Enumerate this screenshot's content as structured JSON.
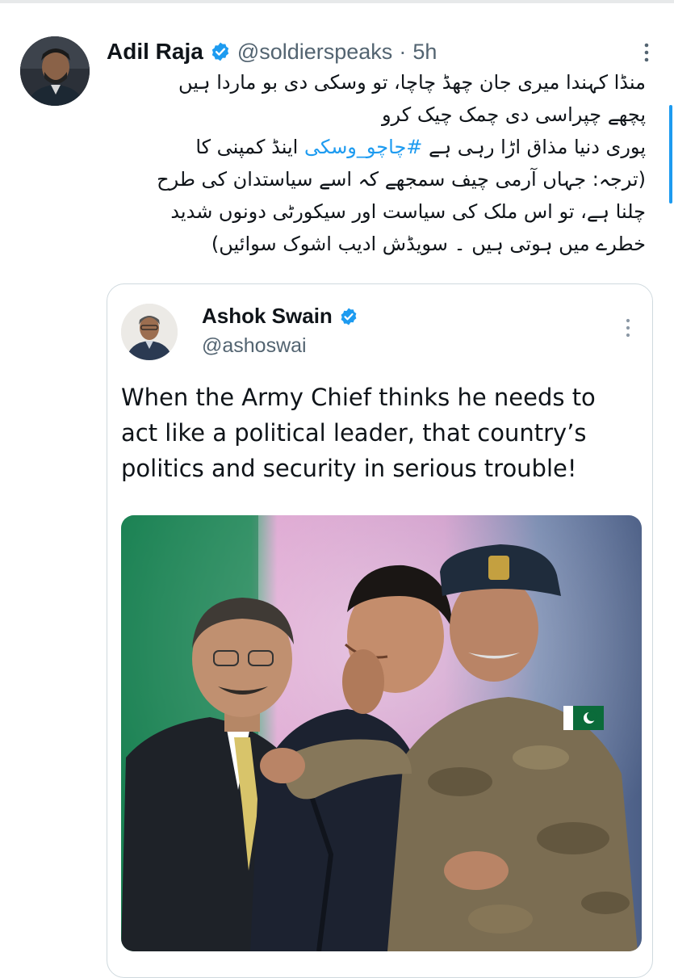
{
  "tweet": {
    "author_name": "Adil Raja",
    "author_handle": "@soldierspeaks",
    "separator": "·",
    "time": "5h",
    "avatar": "author-avatar",
    "verified_icon": "verified-badge-icon",
    "more_icon": "more-options-icon",
    "text_lines": [
      "منڈا کہندا میری جان چھڈ چاچا، تو وسکی دی بو ماردا ہیں",
      "پچھے چپراسی دی چمک چیک کرو",
      "پوری دنیا مذاق اڑا رہی ہے",
      "اینڈ کمپنی کا",
      "(ترجہ: جہاں آرمی چیف سمجھے کہ اسے سیاستدان کی طرح",
      "چلنا ہے، تو اس ملک کی سیاست اور سیکورٹی دونوں شدید",
      "خطرے میں ہوتی ہیں ۔ سویڈش ادیب اشوک سوائیں)"
    ],
    "hashtag": "#چاچو_وسکی"
  },
  "quoted": {
    "author_name": "Ashok Swain",
    "author_handle": "@ashoswai",
    "avatar": "quoted-author-avatar",
    "verified_icon": "verified-badge-icon",
    "more_icon": "more-options-icon",
    "text_lines": [
      "When the Army Chief thinks he needs to",
      "act like a political leader, that country’s",
      "politics and security in serious trouble!"
    ],
    "photo": "photo-embrace"
  },
  "colors": {
    "accent": "#1d9bf0",
    "secondary_text": "#536471",
    "border": "#cfd9de"
  }
}
